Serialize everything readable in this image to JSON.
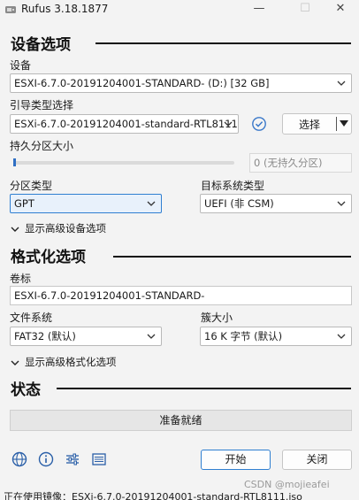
{
  "window": {
    "title": "Rufus 3.18.1877",
    "minimize": "—",
    "maximize": "☐",
    "close": "✕"
  },
  "drive_section": {
    "header": "设备选项",
    "device_label": "设备",
    "device_value": "ESXI-6.7.0-20191204001-STANDARD- (D:) [32 GB]",
    "boot_label": "引导类型选择",
    "boot_value": "ESXi-6.7.0-20191204001-standard-RTL8111.iso",
    "select_button": "选择",
    "persistent_label": "持久分区大小",
    "persistent_value": "0 (无持久分区)",
    "partition_label": "分区类型",
    "partition_value": "GPT",
    "target_label": "目标系统类型",
    "target_value": "UEFI (非 CSM)",
    "advanced_toggle": "显示高级设备选项"
  },
  "format_section": {
    "header": "格式化选项",
    "volume_label": "卷标",
    "volume_value": "ESXI-6.7.0-20191204001-STANDARD-",
    "fs_label": "文件系统",
    "fs_value": "FAT32 (默认)",
    "cluster_label": "簇大小",
    "cluster_value": "16 K 字节 (默认)",
    "advanced_toggle": "显示高级格式化选项"
  },
  "status_section": {
    "header": "状态",
    "status_text": "准备就绪"
  },
  "footer": {
    "start_button": "开始",
    "close_button": "关闭",
    "icons": [
      "globe-icon",
      "info-icon",
      "settings-sliders-icon",
      "log-icon"
    ]
  },
  "statusbar": {
    "text": "正在使用镜像：ESXi-6.7.0-20191204001-standard-RTL8111.iso"
  },
  "watermark": "CSDN @mojieafei",
  "colors": {
    "accent": "#2f7fd1",
    "background": "#f3f3f3",
    "verify_icon": "#3a78c9"
  }
}
